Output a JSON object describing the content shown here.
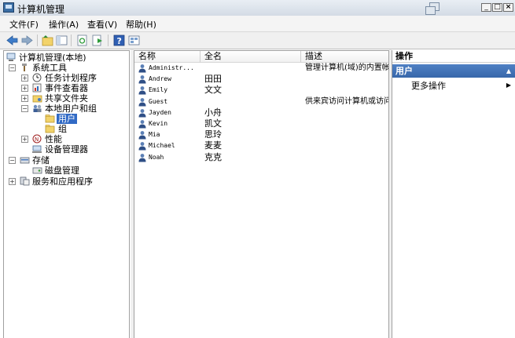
{
  "window": {
    "title": "计算机管理"
  },
  "menu": [
    "文件(F)",
    "操作(A)",
    "查看(V)",
    "帮助(H)"
  ],
  "toolbar": [
    "back-icon",
    "forward-icon",
    "up-folder-icon",
    "show-hide-tree-icon",
    "refresh-icon",
    "export-list-icon",
    "help-icon",
    "view-icon"
  ],
  "tree": {
    "root": "计算机管理(本地)",
    "system_tools": "系统工具",
    "task_scheduler": "任务计划程序",
    "event_viewer": "事件查看器",
    "shared_folders": "共享文件夹",
    "local_users_groups": "本地用户和组",
    "users": "用户",
    "groups": "组",
    "performance": "性能",
    "device_manager": "设备管理器",
    "storage": "存储",
    "disk_management": "磁盘管理",
    "services_apps": "服务和应用程序"
  },
  "list": {
    "columns": [
      "名称",
      "全名",
      "描述"
    ],
    "rows": [
      {
        "name": "Administr...",
        "full": "",
        "desc": "管理计算机(域)的内置帐户"
      },
      {
        "name": "Andrew",
        "full": "田田",
        "desc": ""
      },
      {
        "name": "Emily",
        "full": "文文",
        "desc": ""
      },
      {
        "name": "Guest",
        "full": "",
        "desc": "供来宾访问计算机或访问域的内置帐户"
      },
      {
        "name": "Jayden",
        "full": "小舟",
        "desc": ""
      },
      {
        "name": "Kevin",
        "full": "凯文",
        "desc": ""
      },
      {
        "name": "Mia",
        "full": "思玲",
        "desc": ""
      },
      {
        "name": "Michael",
        "full": "麦麦",
        "desc": ""
      },
      {
        "name": "Noah",
        "full": "克克",
        "desc": ""
      }
    ]
  },
  "actions": {
    "header": "操作",
    "section": "用户",
    "more": "更多操作"
  },
  "colors": {
    "accent": "#3767aa",
    "selection": "#316ac5"
  }
}
